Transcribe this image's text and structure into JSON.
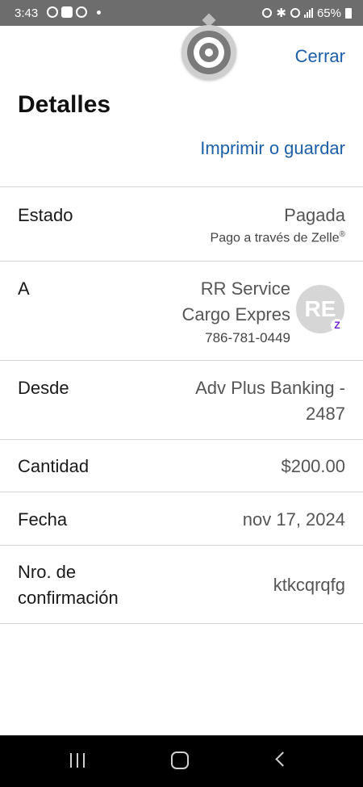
{
  "status_bar": {
    "time": "3:43",
    "battery": "65%",
    "left_icons": [
      "whatsapp-icon",
      "youtube-icon",
      "app-icon",
      "dot-icon"
    ],
    "right_icons": [
      "alarm-icon",
      "bluetooth-icon",
      "wifi-icon",
      "signal-icon",
      "battery-icon"
    ]
  },
  "header": {
    "close_label": "Cerrar",
    "title": "Detalles",
    "print_label": "Imprimir o guardar"
  },
  "details": {
    "estado": {
      "label": "Estado",
      "value": "Pagada",
      "sub": "Pago a través de Zelle",
      "sub_mark": "®"
    },
    "a": {
      "label": "A",
      "name_line1": "RR Service",
      "name_line2": "Cargo Expres",
      "phone": "786-781-0449",
      "avatar_initials": "RE",
      "badge": "Z"
    },
    "desde": {
      "label": "Desde",
      "value_line1": "Adv Plus Banking -",
      "value_line2": "2487"
    },
    "cantidad": {
      "label": "Cantidad",
      "value": "$200.00"
    },
    "fecha": {
      "label": "Fecha",
      "value": "nov 17, 2024"
    },
    "confirmacion": {
      "label_line1": "Nro. de",
      "label_line2": "confirmación",
      "value": "ktkcqrqfg"
    }
  },
  "nav_bar": {
    "icons": [
      "recents-icon",
      "home-icon",
      "back-icon"
    ]
  },
  "colors": {
    "link": "#1b5fa8",
    "status_bar": "#6d6d6d",
    "zelle": "#6d1ed4"
  }
}
